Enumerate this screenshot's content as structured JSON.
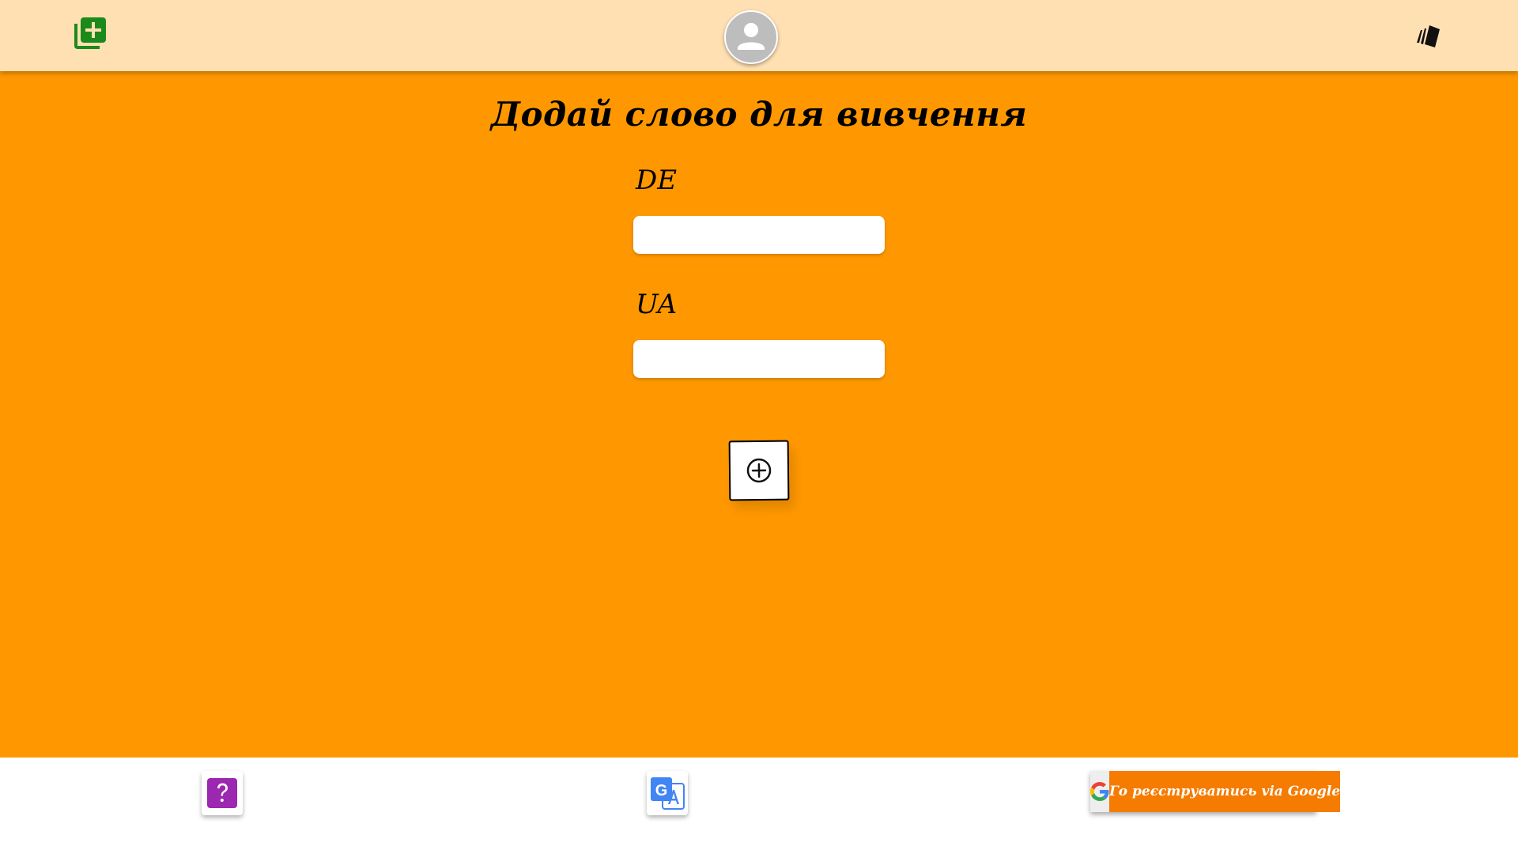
{
  "header": {
    "add_word_icon": "add-to-library-icon",
    "avatar_icon": "user-avatar-icon",
    "cards_icon": "flashcards-icon",
    "colors": {
      "background": "#ffe0b2",
      "add_icon": "#1b8a1b",
      "avatar": "#bdbdbd"
    }
  },
  "main": {
    "title": "Додай слово для вивчення",
    "background": "#ff9800",
    "fields": [
      {
        "label": "DE",
        "value": "",
        "placeholder": ""
      },
      {
        "label": "UA",
        "value": "",
        "placeholder": ""
      }
    ],
    "submit_icon": "plus-circle-icon"
  },
  "footer": {
    "help_icon": "question-icon",
    "translate_icon": "google-translate-icon",
    "google_button": {
      "label": "Го реєструватись via Google",
      "icon": "google-g-icon",
      "color": "#f57c00"
    },
    "colors": {
      "help": "#9c27b0",
      "translate": "#4285f4"
    }
  }
}
